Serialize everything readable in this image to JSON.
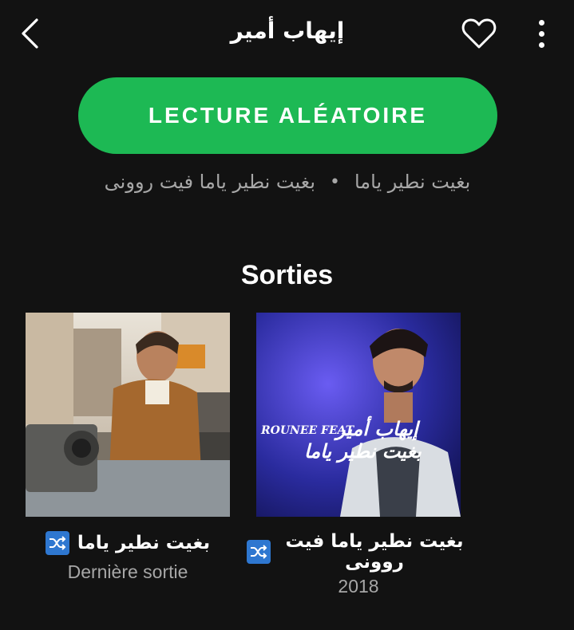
{
  "header": {
    "title": "إيهاب أمير",
    "back_icon": "chevron-left-icon",
    "like_icon": "heart-outline-icon",
    "more_icon": "more-vertical-icon"
  },
  "shuffle": {
    "label": "LECTURE ALÉATOIRE",
    "color": "#1db954"
  },
  "featured": {
    "tracks": [
      "بغيت نطير ياما",
      "بغيت نطير ياما فيت روونى"
    ],
    "separator": "•"
  },
  "releases": {
    "title": "Sorties",
    "items": [
      {
        "title": "بغيت نطير ياما",
        "subtitle": "Dernière sortie",
        "badge_icon": "shuffle-icon"
      },
      {
        "title": "بغيت نطير ياما فيت روونى",
        "subtitle": "2018",
        "badge_icon": "shuffle-icon",
        "cover_text": {
          "artist": "إيهاب أمير",
          "feat": "ROUNEE FEAT",
          "song": "بغيت نطير ياما"
        }
      }
    ]
  }
}
